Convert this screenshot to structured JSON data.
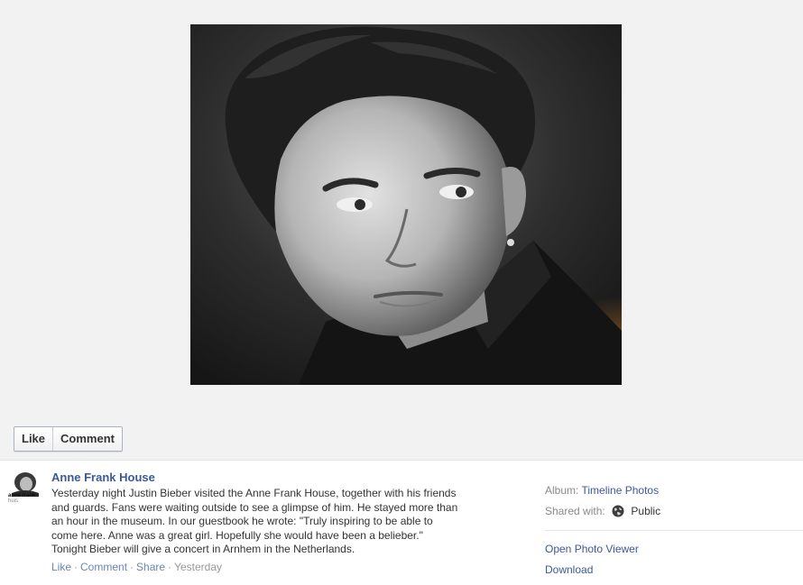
{
  "actions": {
    "like_label": "Like",
    "comment_label": "Comment"
  },
  "avatar": {
    "logo_text_1": "anne frank",
    "logo_text_2": "huis"
  },
  "post": {
    "author": "Anne Frank House",
    "lines": [
      "Yesterday night Justin Bieber visited the Anne Frank House, together with his friends",
      "and guards. Fans were waiting outside to see a glimpse of him. He stayed more than",
      "an hour in the museum. In our guestbook he wrote: \"Truly inspiring to be able to",
      "come here. Anne was a great girl. Hopefully she would have been a belieber.\"",
      "Tonight Bieber will give a concert in Arnhem in the Netherlands."
    ],
    "meta": {
      "like": "Like",
      "comment": "Comment",
      "share": "Share",
      "time": "Yesterday",
      "separator": "·"
    }
  },
  "sidebar": {
    "album_label": "Album:",
    "album_value": "Timeline Photos",
    "shared_label": "Shared with:",
    "shared_value": "Public",
    "shared_icon": "globe-icon",
    "open_viewer": "Open Photo Viewer",
    "download": "Download"
  },
  "colors": {
    "link": "#3b5998",
    "meta_link": "#6d84b4",
    "stage_background": "#f2f2f2"
  }
}
